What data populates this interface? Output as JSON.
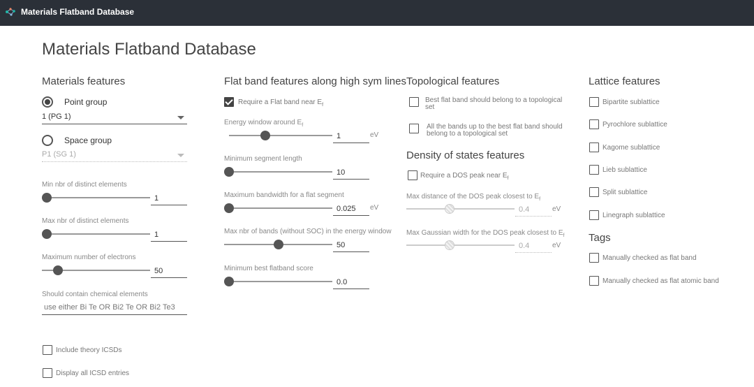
{
  "app": {
    "title": "Materials Flatband Database"
  },
  "page_title": "Materials Flatband Database",
  "materials": {
    "title": "Materials features",
    "point_group_label": "Point group",
    "point_group_value": "1 (PG 1)",
    "space_group_label": "Space group",
    "space_group_value": "P1 (SG 1)",
    "min_elements_label": "Min nbr of distinct elements",
    "min_elements_value": "1",
    "max_elements_label": "Max nbr of distinct elements",
    "max_elements_value": "1",
    "max_electrons_label": "Maximum number of electrons",
    "max_electrons_value": "50",
    "chem_label": "Should contain chemical elements",
    "chem_placeholder": "use either Bi Te OR Bi2 Te OR Bi2 Te3",
    "include_theory": "Include theory ICSDs",
    "display_all": "Display all ICSD entries"
  },
  "flatband": {
    "title": "Flat band features along high sym lines",
    "require_label": "Require a Flat band near E",
    "energy_window_label": "Energy window around E",
    "energy_window_value": "1",
    "energy_window_unit": "eV",
    "min_segment_label": "Minimum segment length",
    "min_segment_value": "10",
    "max_bandwidth_label": "Maximum bandwidth for a flat segment",
    "max_bandwidth_value": "0.025",
    "max_bandwidth_unit": "eV",
    "max_bands_label": "Max nbr of bands (without SOC) in the energy window",
    "max_bands_value": "50",
    "min_score_label": "Minimum best flatband score",
    "min_score_value": "0.0",
    "sub_f": "f"
  },
  "topological": {
    "title": "Topological features",
    "best_flat_line1": "Best flat band should belong to a topological",
    "best_flat_line2": "set",
    "all_bands_line1": "All the bands up to the best flat band should",
    "all_bands_line2": "belong to a topological set"
  },
  "dos": {
    "title": "Density of states features",
    "require_label": "Require a DOS peak near E",
    "max_distance_label": "Max distance of the DOS peak closest to E",
    "max_distance_value": "0.4",
    "max_distance_unit": "eV",
    "max_gauss_label": "Max Gaussian width for the DOS peak closest to E",
    "max_gauss_value": "0.4",
    "max_gauss_unit": "eV"
  },
  "lattice": {
    "title": "Lattice features",
    "items": [
      "Bipartite sublattice",
      "Pyrochlore sublattice",
      "Kagome sublattice",
      "Lieb sublattice",
      "Split sublattice",
      "Linegraph sublattice"
    ]
  },
  "tags": {
    "title": "Tags",
    "items": [
      "Manually checked as flat band",
      "Manually checked as flat atomic band"
    ]
  },
  "slider_levels": {
    "min_elements": 0.0,
    "max_elements": 0.0,
    "max_electrons": 0.15,
    "energy_window": 0.35,
    "min_segment": 0.0,
    "max_bandwidth": 0.0,
    "max_bands": 0.5,
    "min_score": 0.0,
    "max_distance": 0.4,
    "max_gauss": 0.4
  },
  "colors": {
    "topbar": "#2b3038",
    "accent": "#444444",
    "logo": "#1fb8a8"
  }
}
